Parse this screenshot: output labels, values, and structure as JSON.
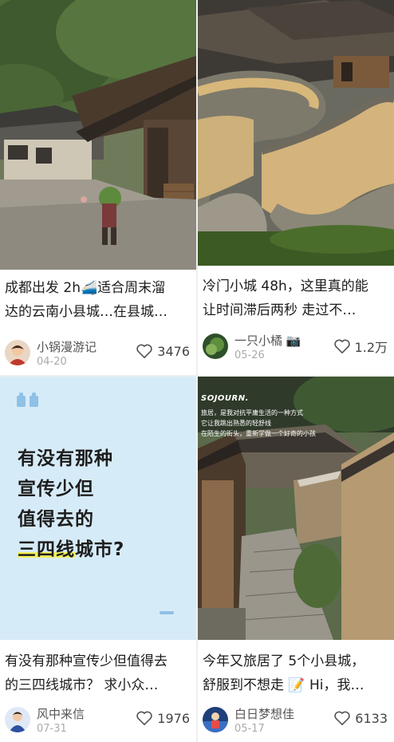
{
  "feed": {
    "cards": [
      {
        "title_line1": "成都出发 2h🚄适合周末溜",
        "title_line2": "达的云南小县城…在县城…",
        "author": "小锅漫游记",
        "date": "04-20",
        "likes": "3476",
        "image": "photo-village-stone-square"
      },
      {
        "title_line1": "冷门小城 48h，这里真的能",
        "title_line2": "让时间滞后两秒 走过不…",
        "author": "一只小橘 📷",
        "date": "05-26",
        "likes": "1.2万",
        "image": "photo-curved-earthen-walls"
      },
      {
        "quote_lines": [
          "有没有那种",
          "宣传少但",
          "值得去的"
        ],
        "quote_highlight": "三四线",
        "quote_tail": "城市?",
        "title_line1": "有没有那种宣传少但值得去",
        "title_line2": "的三四线城市？ 求小众…",
        "author": "风中来信",
        "date": "07-31",
        "likes": "1976",
        "image": "quote-card"
      },
      {
        "overlay_brand": "SOJOURN.",
        "overlay_lines": [
          "旅居，是我对抗平庸生活的一种方式",
          "它让我跳出熟悉的轻舒线",
          "在陌生的街头，重新学做一个好奇的小孩"
        ],
        "title_line1": "今年又旅居了 5个小县城，",
        "title_line2": "舒服到不想走 📝 Hi，我…",
        "author": "白日梦想佳",
        "date": "05-17",
        "likes": "6133",
        "image": "photo-stone-stair-lane"
      }
    ]
  },
  "colors": {
    "quote_bg": "#d6ebf8",
    "quote_mark": "#8fc0e6",
    "highlight": "#f2ef5c"
  }
}
